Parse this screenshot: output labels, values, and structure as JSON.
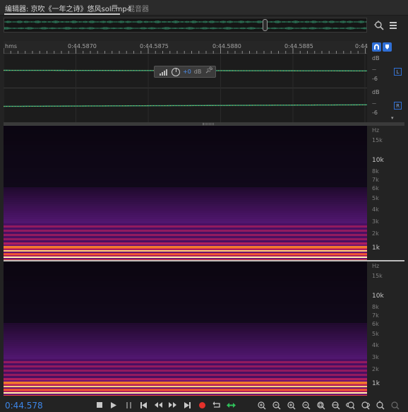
{
  "tabs": {
    "editor_label": "编辑器: 京吹《一年之诗》悠风soli.mp4",
    "menu_glyph": "≡",
    "mixer_label": "混音器"
  },
  "overview": {
    "zoom_nav_icon": "zoom-navigator-icon",
    "panel_menu_icon": "panel-menu-icon"
  },
  "ruler": {
    "unit": "hms",
    "ticks": [
      "0:44.5870",
      "0:44.5875",
      "0:44.5880",
      "0:44.5885",
      "0:44"
    ]
  },
  "waveform": {
    "db_unit": "dB",
    "db_mark": "-6",
    "left_channel": "L",
    "right_channel": "R",
    "hud": {
      "volume": "+0",
      "unit": "dB"
    }
  },
  "spectral": {
    "unit": "Hz",
    "labels": [
      "15k",
      "10k",
      "8k",
      "7k",
      "6k",
      "5k",
      "4k",
      "3k",
      "2k",
      "1k"
    ]
  },
  "transport": {
    "time": "0:44.578"
  },
  "colors": {
    "accent": "#2f6fd6",
    "time": "#3d86e8",
    "wave_left": "#3aa57a",
    "wave_right": "#3aa57a",
    "record": "#e4312b"
  }
}
